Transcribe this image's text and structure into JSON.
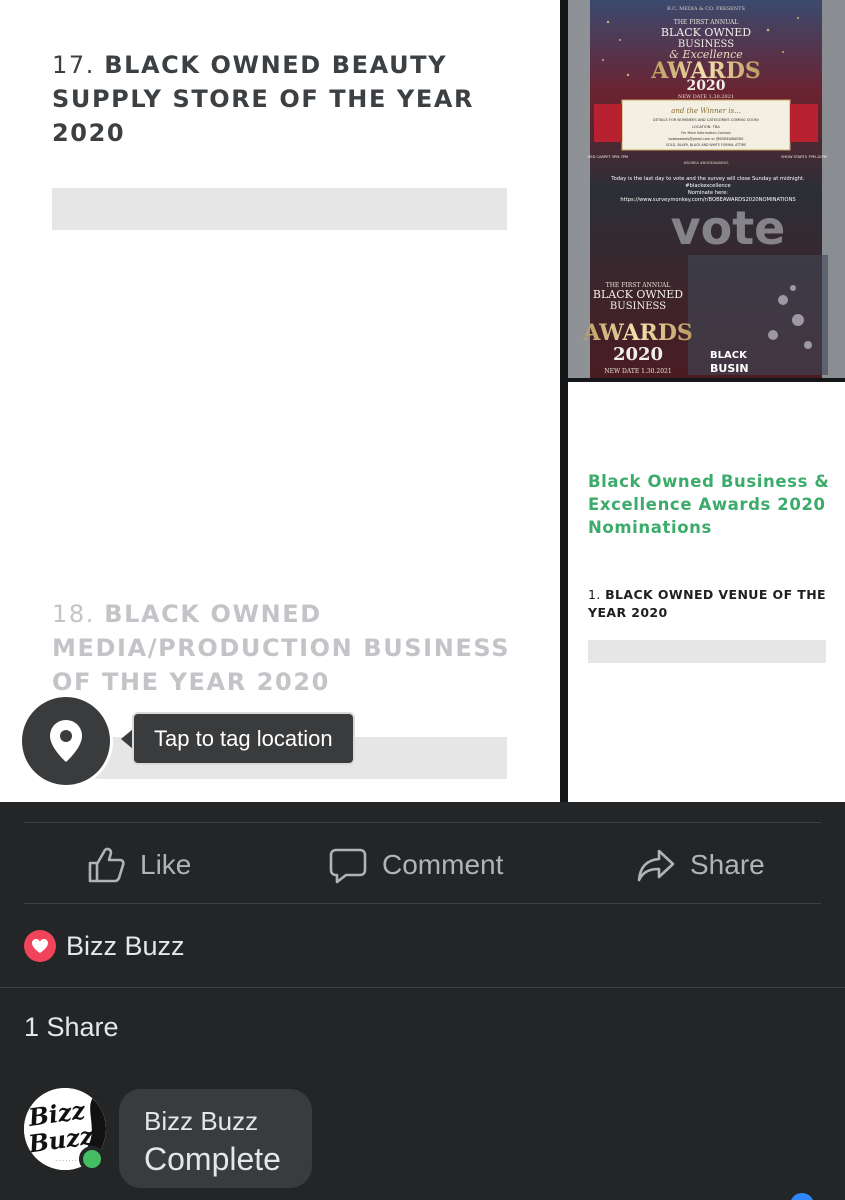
{
  "photo_left": {
    "q17_number": "17.",
    "q17_text": "BLACK OWNED BEAUTY SUPPLY STORE OF THE YEAR 2020",
    "q18_number": "18.",
    "q18_text": "BLACK OWNED MEDIA/PRODUCTION BUSINESS OF THE YEAR 2020"
  },
  "poster": {
    "publisher": "B.C. MEDIA & CO. PRESENTS",
    "line1": "THE FIRST ANNUAL",
    "line2": "BLACK OWNED",
    "line3": "BUSINESS",
    "line4": "& Excellence",
    "line5": "AWARDS",
    "line6": "2020",
    "line7": "NEW DATE 1.30.2021",
    "winner": "and the Winner is...",
    "details": "DETAILS FOR NOMINEES AND CATEGORIES COMING SOON!",
    "location": "LOCATION: TBA",
    "contact": "For More Information Contact",
    "email": "bobeawards@gmail.com or @BOBEAWARDS",
    "attire": "GOLD, SILVER, BLACK AND WHITE FORMAL ATTIRE",
    "red_carpet": "RED CARPET 5PM-7PM",
    "show_starts": "SHOW STARTS 7PM-10PM",
    "hashtags": "#BOBEA #BOBEAWARDS",
    "vote_note": "Today is the last day to vote and the survey will close Sunday at midnight. #blackexcellence",
    "nominate": "Nominate here:",
    "url": "https://www.surveymonkey.com/r/BOBEAWARDS2020NOMINATIONS",
    "vote_word": "vote",
    "line2_bottom": "THE FIRST ANNUAL",
    "line3_bottom": "BLACK OWNED",
    "line4_bottom": "BUSINESS",
    "line5_bottom": "AWARDS",
    "line6_bottom": "2020",
    "line7_bottom": "NEW DATE 1.30.2021",
    "corner_text1": "BLACK",
    "corner_text2": "BUSIN"
  },
  "photo_right_bottom": {
    "heading": "Black Owned Business & Excellence Awards 2020 Nominations",
    "q1_number": "1.",
    "q1_text": "BLACK OWNED VENUE OF THE YEAR 2020"
  },
  "location_tag": {
    "tooltip": "Tap to tag location",
    "icon": "location-pin-icon"
  },
  "actions": {
    "like": "Like",
    "comment": "Comment",
    "share": "Share"
  },
  "reactions": {
    "reactor_name": "Bizz Buzz",
    "icon": "heart-icon",
    "color": "#f0445b"
  },
  "shares": {
    "count_label": "1 Share"
  },
  "sharer": {
    "name": "Bizz Buzz",
    "text": "Complete",
    "avatar_text": "Bizz Buzz",
    "online_color": "#45bd62"
  },
  "theme": {
    "background": "#242526",
    "text_secondary": "#b0b3b8",
    "accent_green": "#3dab6b"
  }
}
